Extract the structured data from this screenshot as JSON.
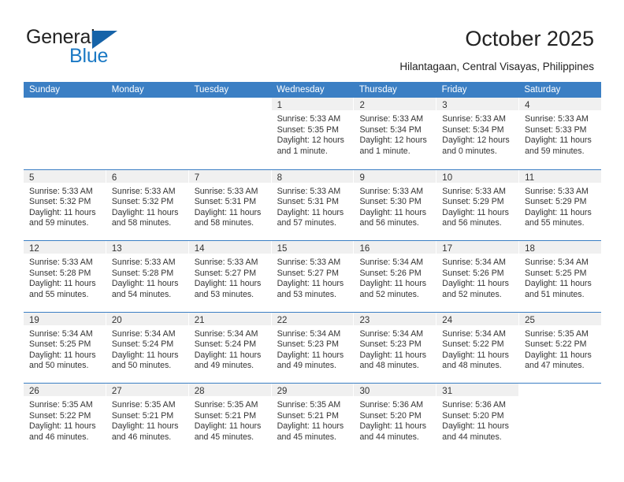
{
  "brand": {
    "name_part1": "General",
    "name_part2": "Blue",
    "triangle_color": "#1663a8",
    "blue_text_color": "#1b79c4"
  },
  "header": {
    "title": "October 2025",
    "subtitle": "Hilantagaan, Central Visayas, Philippines"
  },
  "theme": {
    "header_blue": "#3b7fc4",
    "daynum_strip": "#f0f0f0",
    "text": "#333333"
  },
  "weekdays": [
    "Sunday",
    "Monday",
    "Tuesday",
    "Wednesday",
    "Thursday",
    "Friday",
    "Saturday"
  ],
  "weeks": [
    [
      {
        "day": "",
        "blank": true
      },
      {
        "day": "",
        "blank": true
      },
      {
        "day": "",
        "blank": true
      },
      {
        "day": "1",
        "sunrise": "Sunrise: 5:33 AM",
        "sunset": "Sunset: 5:35 PM",
        "daylight_l1": "Daylight: 12 hours",
        "daylight_l2": "and 1 minute."
      },
      {
        "day": "2",
        "sunrise": "Sunrise: 5:33 AM",
        "sunset": "Sunset: 5:34 PM",
        "daylight_l1": "Daylight: 12 hours",
        "daylight_l2": "and 1 minute."
      },
      {
        "day": "3",
        "sunrise": "Sunrise: 5:33 AM",
        "sunset": "Sunset: 5:34 PM",
        "daylight_l1": "Daylight: 12 hours",
        "daylight_l2": "and 0 minutes."
      },
      {
        "day": "4",
        "sunrise": "Sunrise: 5:33 AM",
        "sunset": "Sunset: 5:33 PM",
        "daylight_l1": "Daylight: 11 hours",
        "daylight_l2": "and 59 minutes."
      }
    ],
    [
      {
        "day": "5",
        "sunrise": "Sunrise: 5:33 AM",
        "sunset": "Sunset: 5:32 PM",
        "daylight_l1": "Daylight: 11 hours",
        "daylight_l2": "and 59 minutes."
      },
      {
        "day": "6",
        "sunrise": "Sunrise: 5:33 AM",
        "sunset": "Sunset: 5:32 PM",
        "daylight_l1": "Daylight: 11 hours",
        "daylight_l2": "and 58 minutes."
      },
      {
        "day": "7",
        "sunrise": "Sunrise: 5:33 AM",
        "sunset": "Sunset: 5:31 PM",
        "daylight_l1": "Daylight: 11 hours",
        "daylight_l2": "and 58 minutes."
      },
      {
        "day": "8",
        "sunrise": "Sunrise: 5:33 AM",
        "sunset": "Sunset: 5:31 PM",
        "daylight_l1": "Daylight: 11 hours",
        "daylight_l2": "and 57 minutes."
      },
      {
        "day": "9",
        "sunrise": "Sunrise: 5:33 AM",
        "sunset": "Sunset: 5:30 PM",
        "daylight_l1": "Daylight: 11 hours",
        "daylight_l2": "and 56 minutes."
      },
      {
        "day": "10",
        "sunrise": "Sunrise: 5:33 AM",
        "sunset": "Sunset: 5:29 PM",
        "daylight_l1": "Daylight: 11 hours",
        "daylight_l2": "and 56 minutes."
      },
      {
        "day": "11",
        "sunrise": "Sunrise: 5:33 AM",
        "sunset": "Sunset: 5:29 PM",
        "daylight_l1": "Daylight: 11 hours",
        "daylight_l2": "and 55 minutes."
      }
    ],
    [
      {
        "day": "12",
        "sunrise": "Sunrise: 5:33 AM",
        "sunset": "Sunset: 5:28 PM",
        "daylight_l1": "Daylight: 11 hours",
        "daylight_l2": "and 55 minutes."
      },
      {
        "day": "13",
        "sunrise": "Sunrise: 5:33 AM",
        "sunset": "Sunset: 5:28 PM",
        "daylight_l1": "Daylight: 11 hours",
        "daylight_l2": "and 54 minutes."
      },
      {
        "day": "14",
        "sunrise": "Sunrise: 5:33 AM",
        "sunset": "Sunset: 5:27 PM",
        "daylight_l1": "Daylight: 11 hours",
        "daylight_l2": "and 53 minutes."
      },
      {
        "day": "15",
        "sunrise": "Sunrise: 5:33 AM",
        "sunset": "Sunset: 5:27 PM",
        "daylight_l1": "Daylight: 11 hours",
        "daylight_l2": "and 53 minutes."
      },
      {
        "day": "16",
        "sunrise": "Sunrise: 5:34 AM",
        "sunset": "Sunset: 5:26 PM",
        "daylight_l1": "Daylight: 11 hours",
        "daylight_l2": "and 52 minutes."
      },
      {
        "day": "17",
        "sunrise": "Sunrise: 5:34 AM",
        "sunset": "Sunset: 5:26 PM",
        "daylight_l1": "Daylight: 11 hours",
        "daylight_l2": "and 52 minutes."
      },
      {
        "day": "18",
        "sunrise": "Sunrise: 5:34 AM",
        "sunset": "Sunset: 5:25 PM",
        "daylight_l1": "Daylight: 11 hours",
        "daylight_l2": "and 51 minutes."
      }
    ],
    [
      {
        "day": "19",
        "sunrise": "Sunrise: 5:34 AM",
        "sunset": "Sunset: 5:25 PM",
        "daylight_l1": "Daylight: 11 hours",
        "daylight_l2": "and 50 minutes."
      },
      {
        "day": "20",
        "sunrise": "Sunrise: 5:34 AM",
        "sunset": "Sunset: 5:24 PM",
        "daylight_l1": "Daylight: 11 hours",
        "daylight_l2": "and 50 minutes."
      },
      {
        "day": "21",
        "sunrise": "Sunrise: 5:34 AM",
        "sunset": "Sunset: 5:24 PM",
        "daylight_l1": "Daylight: 11 hours",
        "daylight_l2": "and 49 minutes."
      },
      {
        "day": "22",
        "sunrise": "Sunrise: 5:34 AM",
        "sunset": "Sunset: 5:23 PM",
        "daylight_l1": "Daylight: 11 hours",
        "daylight_l2": "and 49 minutes."
      },
      {
        "day": "23",
        "sunrise": "Sunrise: 5:34 AM",
        "sunset": "Sunset: 5:23 PM",
        "daylight_l1": "Daylight: 11 hours",
        "daylight_l2": "and 48 minutes."
      },
      {
        "day": "24",
        "sunrise": "Sunrise: 5:34 AM",
        "sunset": "Sunset: 5:22 PM",
        "daylight_l1": "Daylight: 11 hours",
        "daylight_l2": "and 48 minutes."
      },
      {
        "day": "25",
        "sunrise": "Sunrise: 5:35 AM",
        "sunset": "Sunset: 5:22 PM",
        "daylight_l1": "Daylight: 11 hours",
        "daylight_l2": "and 47 minutes."
      }
    ],
    [
      {
        "day": "26",
        "sunrise": "Sunrise: 5:35 AM",
        "sunset": "Sunset: 5:22 PM",
        "daylight_l1": "Daylight: 11 hours",
        "daylight_l2": "and 46 minutes."
      },
      {
        "day": "27",
        "sunrise": "Sunrise: 5:35 AM",
        "sunset": "Sunset: 5:21 PM",
        "daylight_l1": "Daylight: 11 hours",
        "daylight_l2": "and 46 minutes."
      },
      {
        "day": "28",
        "sunrise": "Sunrise: 5:35 AM",
        "sunset": "Sunset: 5:21 PM",
        "daylight_l1": "Daylight: 11 hours",
        "daylight_l2": "and 45 minutes."
      },
      {
        "day": "29",
        "sunrise": "Sunrise: 5:35 AM",
        "sunset": "Sunset: 5:21 PM",
        "daylight_l1": "Daylight: 11 hours",
        "daylight_l2": "and 45 minutes."
      },
      {
        "day": "30",
        "sunrise": "Sunrise: 5:36 AM",
        "sunset": "Sunset: 5:20 PM",
        "daylight_l1": "Daylight: 11 hours",
        "daylight_l2": "and 44 minutes."
      },
      {
        "day": "31",
        "sunrise": "Sunrise: 5:36 AM",
        "sunset": "Sunset: 5:20 PM",
        "daylight_l1": "Daylight: 11 hours",
        "daylight_l2": "and 44 minutes."
      },
      {
        "day": "",
        "blank": true
      }
    ]
  ]
}
